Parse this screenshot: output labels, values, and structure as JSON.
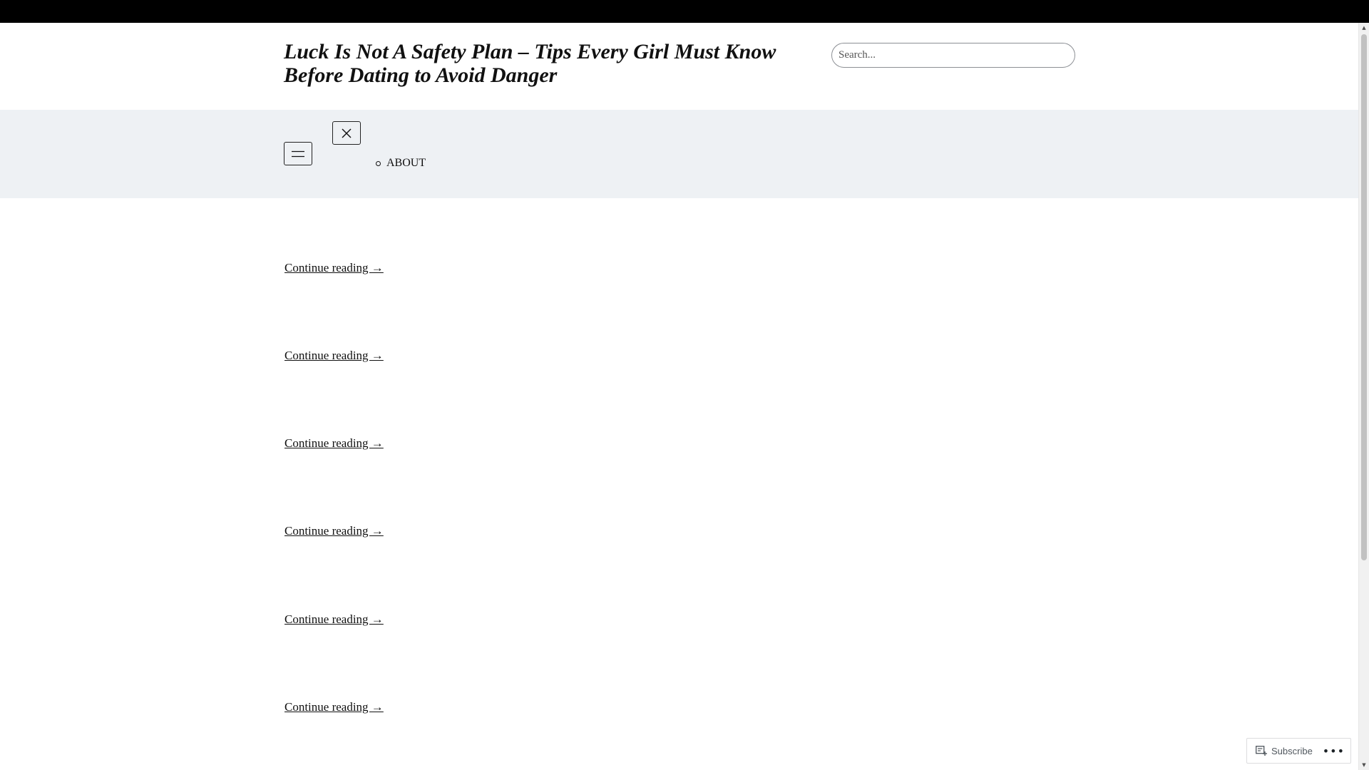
{
  "site": {
    "title": "Luck Is Not A Safety Plan – Tips Every Girl Must Know Before Dating to Avoid Danger"
  },
  "search": {
    "placeholder": "Search..."
  },
  "navigation": {
    "open_icon": "hamburger-menu-icon",
    "close_icon": "close-icon",
    "items": [
      {
        "label": "ABOUT"
      }
    ]
  },
  "posts": [
    {
      "link_text": "Continue reading →"
    },
    {
      "link_text": "Continue reading →"
    },
    {
      "link_text": "Continue reading →"
    },
    {
      "link_text": "Continue reading →"
    },
    {
      "link_text": "Continue reading →"
    },
    {
      "link_text": "Continue reading →"
    }
  ],
  "subscribe_bar": {
    "label": "Subscribe",
    "icon": "reader-subscribe-icon",
    "more_icon": "ellipsis-icon"
  },
  "colors": {
    "admin_bar": "#000000",
    "nav_band": "#eef1f4",
    "text": "#111111"
  }
}
